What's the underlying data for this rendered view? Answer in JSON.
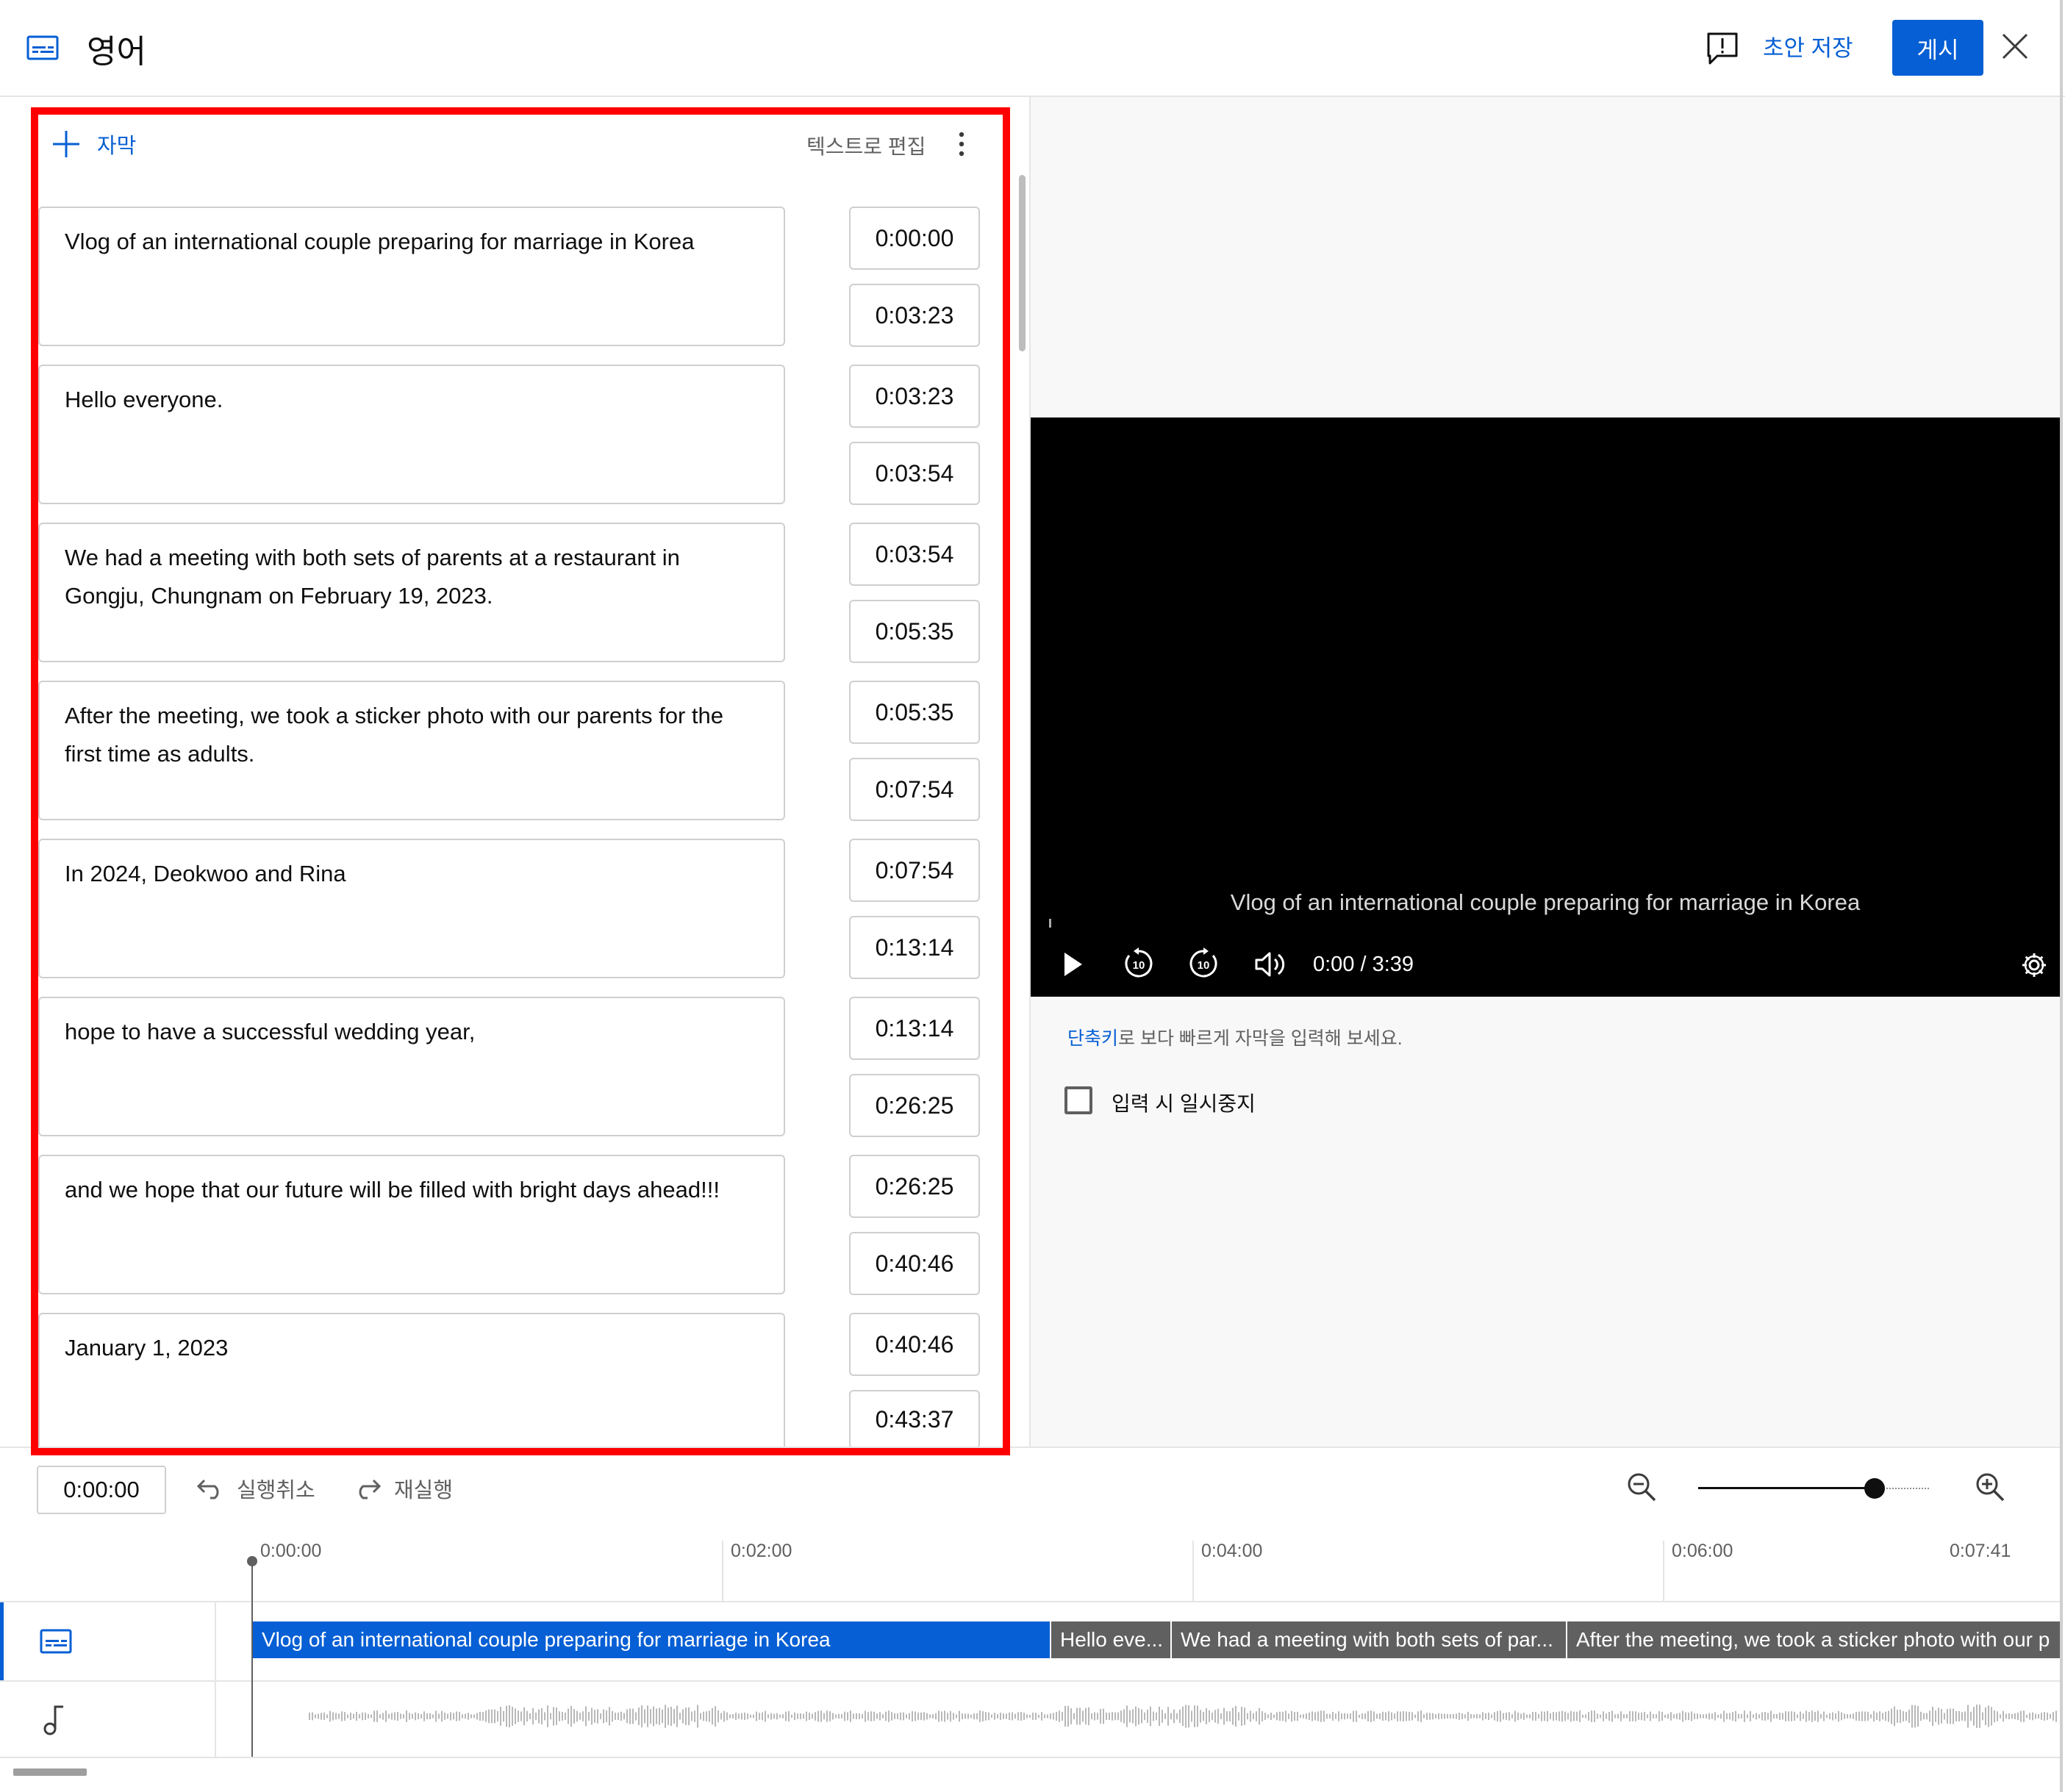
{
  "header": {
    "title": "영어",
    "save_draft": "초안 저장",
    "publish": "게시"
  },
  "editor": {
    "add_subtitle": "자막",
    "edit_as_text": "텍스트로 편집",
    "cues": [
      {
        "text": "Vlog of an international couple preparing for marriage in Korea",
        "start": "0:00:00",
        "end": "0:03:23"
      },
      {
        "text": "Hello everyone.",
        "start": "0:03:23",
        "end": "0:03:54"
      },
      {
        "text": "We had a meeting with both sets of parents at a restaurant in Gongju, Chungnam on February 19, 2023.",
        "start": "0:03:54",
        "end": "0:05:35"
      },
      {
        "text": "After the meeting, we took a sticker photo with our parents for the first time as adults.",
        "start": "0:05:35",
        "end": "0:07:54"
      },
      {
        "text": "In 2024, Deokwoo and Rina",
        "start": "0:07:54",
        "end": "0:13:14"
      },
      {
        "text": "hope to have a successful wedding year,",
        "start": "0:13:14",
        "end": "0:26:25"
      },
      {
        "text": "and we hope that our future will be filled with bright days ahead!!!",
        "start": "0:26:25",
        "end": "0:40:46"
      },
      {
        "text": "January 1, 2023",
        "start": "0:40:46",
        "end": "0:43:37"
      }
    ]
  },
  "player": {
    "caption": "Vlog of an international couple preparing for marriage in Korea",
    "time": "0:00 / 3:39",
    "shortcut_link": "단축키",
    "shortcut_rest": "로 보다 빠르게 자막을 입력해 보세요.",
    "pause_while_typing": "입력 시 일시중지"
  },
  "toolbar": {
    "current_time": "0:00:00",
    "undo": "실행취소",
    "redo": "재실행"
  },
  "timeline": {
    "ruler": [
      "0:00:00",
      "0:02:00",
      "0:04:00",
      "0:06:00",
      "0:07:41"
    ],
    "segments": [
      "Vlog of an international couple preparing for marriage in Korea",
      "Hello eve...",
      "We had a meeting with both sets of par...",
      "After the meeting, we took a sticker photo with our p"
    ]
  },
  "colors": {
    "accent": "#065fd4",
    "highlight_box": "#ff0000",
    "segment_gray": "#606060"
  }
}
